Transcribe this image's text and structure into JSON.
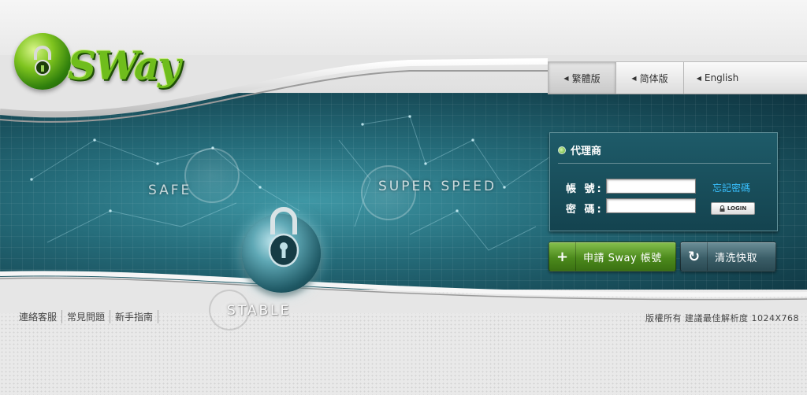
{
  "brand": {
    "logo_text": "SWay"
  },
  "language_bar": {
    "tabs": [
      {
        "label": "繁體版",
        "active": true
      },
      {
        "label": "简体版",
        "active": false
      },
      {
        "label": "English",
        "active": false
      }
    ]
  },
  "banner": {
    "slogans": {
      "safe": "SAFE",
      "speed": "SUPER SPEED",
      "stable": "STABLE"
    }
  },
  "login_panel": {
    "title": "代理商",
    "account_label": "帳 號:",
    "account_value": "",
    "password_label": "密 碼:",
    "password_value": "",
    "forgot_link": "忘記密碼",
    "login_button": "LOGIN"
  },
  "actions": {
    "apply_label": "申請 Sway 帳號",
    "clear_label": "清洗快取"
  },
  "footer": {
    "links": [
      "連絡客服",
      "常見問題",
      "新手指南"
    ],
    "copyright": "版權所有 建議最佳解析度 1024X768"
  },
  "colors": {
    "brand_green": "#6fbd1c",
    "banner_teal": "#256c7a",
    "link_blue": "#39c0ff",
    "apply_green": "#4c8a1c",
    "clear_slate": "#3b5e68"
  }
}
